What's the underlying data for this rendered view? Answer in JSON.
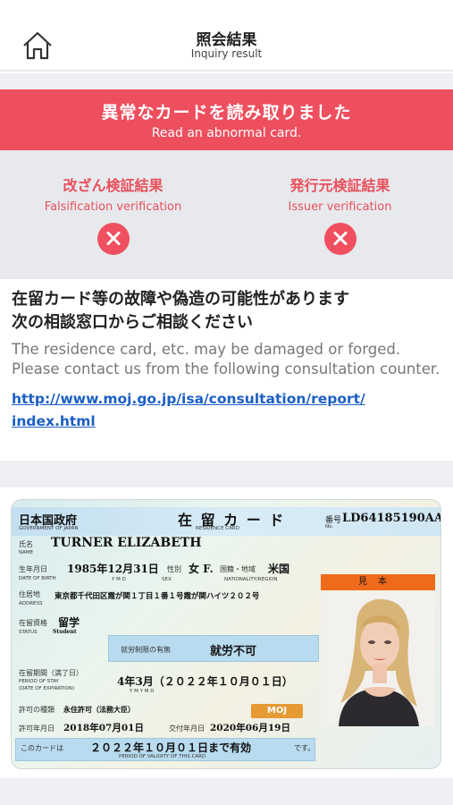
{
  "header": {
    "title": "照会結果",
    "subtitle": "Inquiry result",
    "home_icon": "home-icon"
  },
  "alert": {
    "title": "異常なカードを読み取りました",
    "subtitle": "Read an abnormal card.",
    "color": "#ee4f5e"
  },
  "verification": [
    {
      "title": "改ざん検証結果",
      "subtitle": "Falsification verification",
      "result_icon": "x-circle-icon"
    },
    {
      "title": "発行元検証結果",
      "subtitle": "Issuer verification",
      "result_icon": "x-circle-icon"
    }
  ],
  "message": {
    "jp_line1": "在留カード等の故障や偽造の可能性があります",
    "jp_line2": "次の相談窓口からご相談ください",
    "en": "The residence card, etc. may be damaged or forged. Please contact us from the following consultation counter.",
    "link_line1": "http://www.moj.go.jp/isa/consultation/report/",
    "link_line2": "index.html"
  },
  "card": {
    "issuer": "日本国政府",
    "issuer_en": "GOVERNMENT OF JAPAN",
    "title": "在 留 カ ー ド",
    "title_en": "RESIDENCE CARD",
    "number_label": "番号",
    "number_label_en": "No.",
    "number": "LD64185190AA",
    "name_label": "氏名",
    "name_label_en": "NAME",
    "name": "TURNER  ELIZABETH",
    "dob_label": "生年月日",
    "dob_label_en": "DATE OF BIRTH",
    "dob": "1985年12月31日",
    "dob_ymd": "Y   M   D",
    "sex_label": "性別",
    "sex_label_en": "SEX",
    "sex": "女 F.",
    "nationality_label": "国籍・地域",
    "nationality_label_en": "NATIONALITY/REGION",
    "nationality": "米国",
    "sample_tag": "見本",
    "address_label": "住居地",
    "address_label_en": "ADDRESS",
    "address": "東京都千代田区霞が関１丁目１番１号霞が関ハイツ２０２号",
    "status_label": "在留資格",
    "status_label_en": "STATUS",
    "status": "留学",
    "status_en": "Student",
    "work_label": "就労制限の有無",
    "work": "就労不可",
    "period_label": "在留期間（満了日）",
    "period_label_en1": "PERIOD OF STAY",
    "period_label_en2": "(DATE OF EXPIRATION)",
    "period": "4年3月（２０２２年１０月０１日）",
    "period_ymd": "Y   M          Y   M   D",
    "permit_kind_label": "許可の種類",
    "permit_kind": "永住許可（法務大臣）",
    "permit_date_label": "許可年月日",
    "permit_date": "2018年07月01日",
    "issue_date_label": "交付年月日",
    "issue_date": "2020年06月19日",
    "moj": "MOJ",
    "validity_prefix": "このカードは",
    "validity": "２０２２年１０月０１日まで有効",
    "validity_suffix": "です。",
    "validity_en": "PERIOD OF VALIDITY OF THIS CARD"
  }
}
